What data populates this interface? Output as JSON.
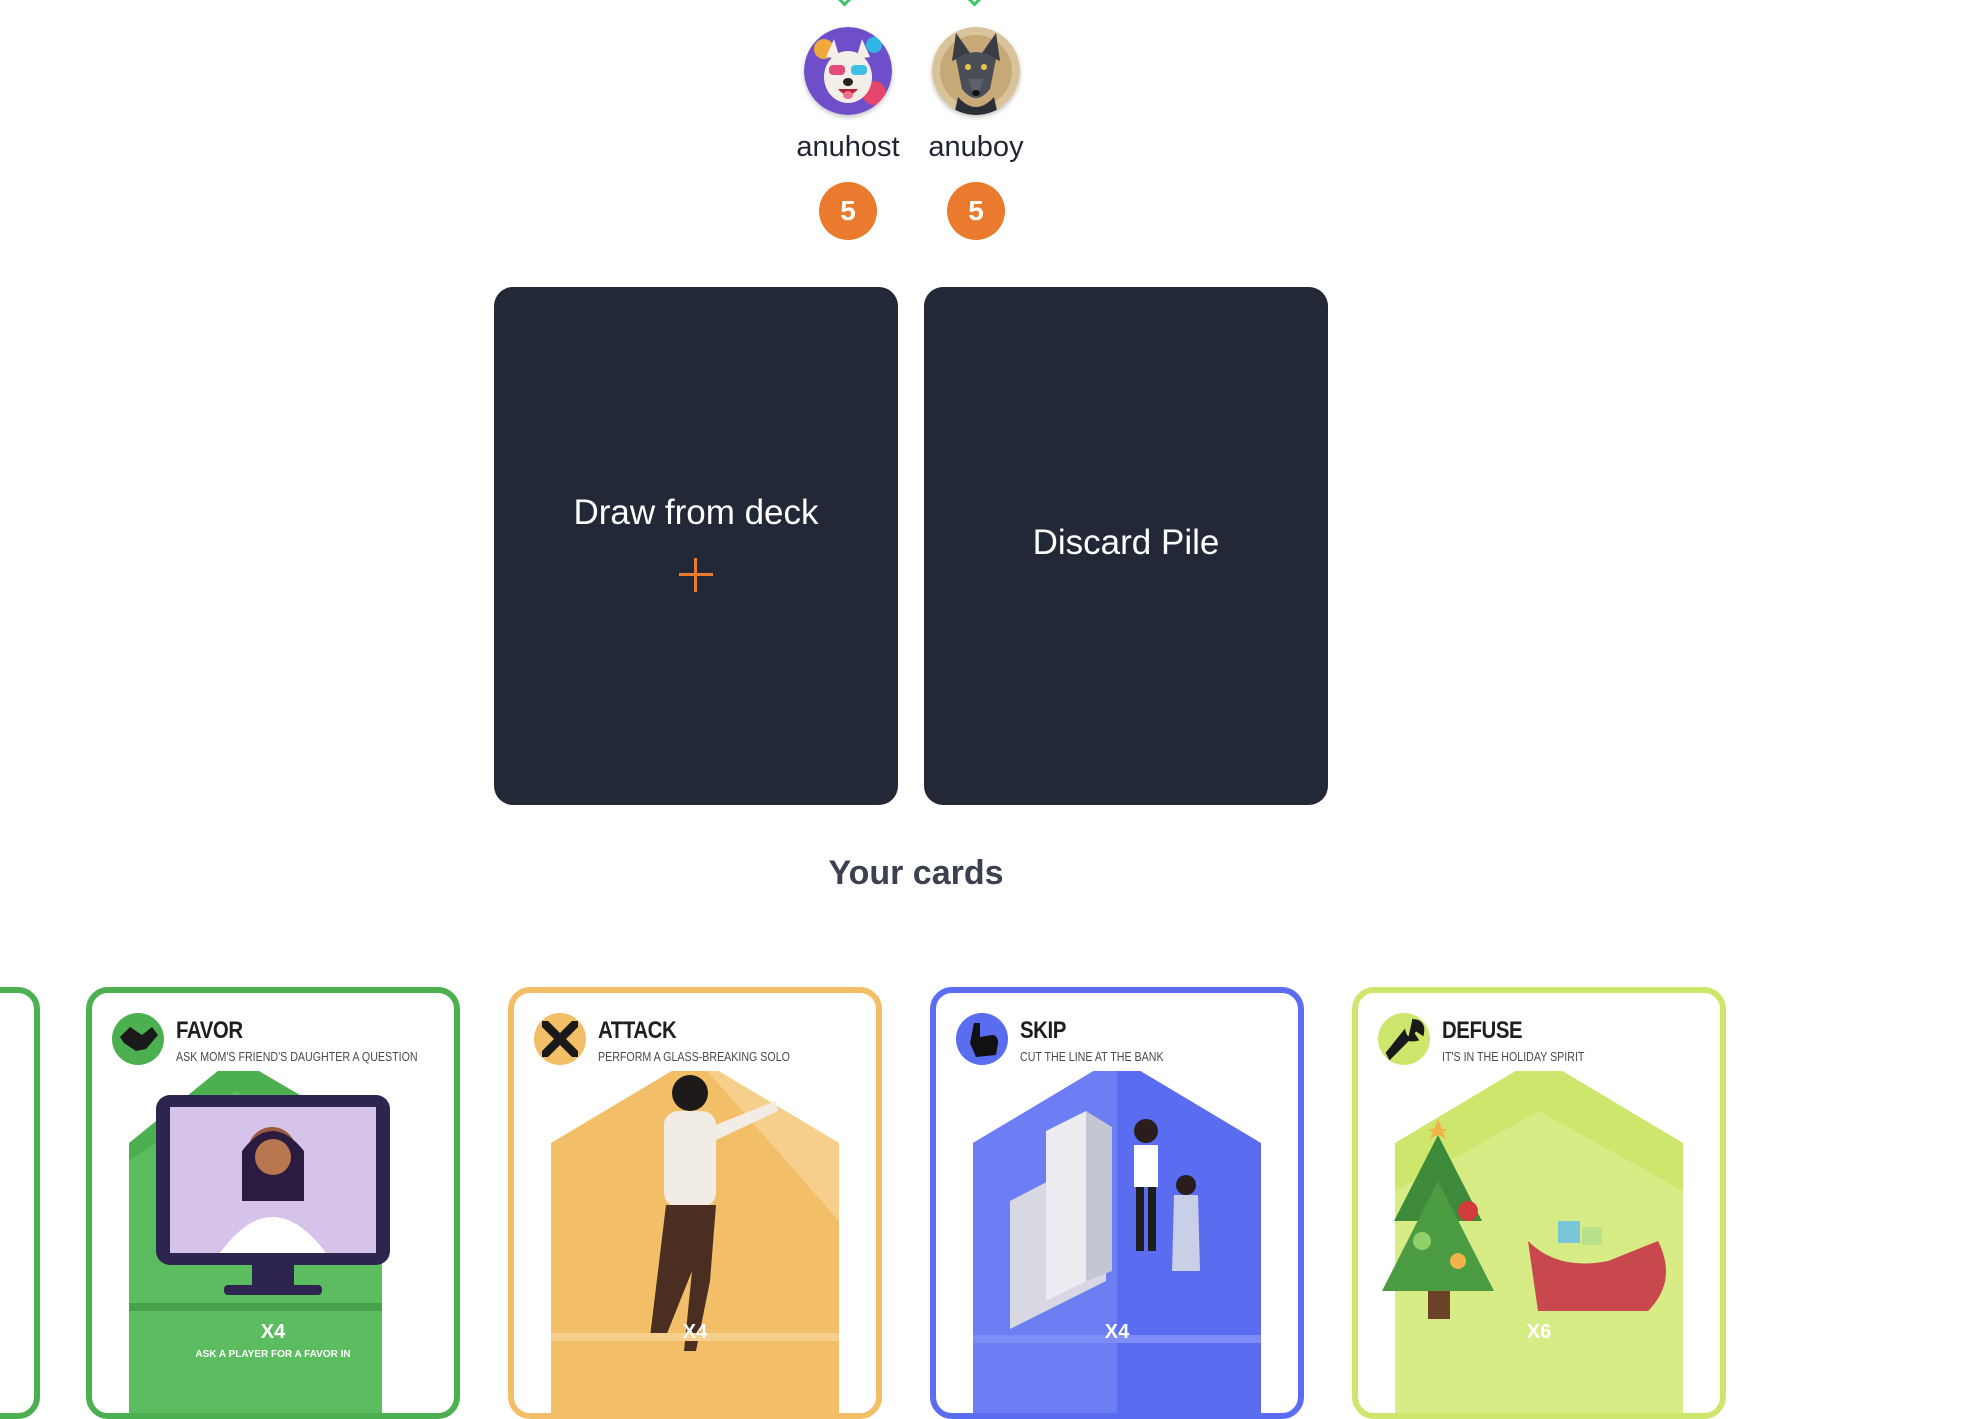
{
  "players": [
    {
      "name": "anuhost",
      "card_count": "5",
      "avatar": "dog-avatar-icon"
    },
    {
      "name": "anuboy",
      "card_count": "5",
      "avatar": "wolf-avatar-icon"
    }
  ],
  "piles": {
    "draw_label": "Draw from deck",
    "discard_label": "Discard Pile"
  },
  "hand": {
    "title": "Your cards",
    "cards": [
      {
        "name": "FAVOR",
        "subtitle": "ASK MOM'S FRIEND'S DAUGHTER A QUESTION",
        "multiplier": "X4",
        "text": "ASK A PLAYER FOR A FAVOR IN",
        "color": "#4caf50",
        "icon": "handshake-icon"
      },
      {
        "name": "ATTACK",
        "subtitle": "PERFORM A GLASS-BREAKING SOLO",
        "multiplier": "X4",
        "text": "",
        "color": "#f3be68",
        "icon": "crossed-swords-icon"
      },
      {
        "name": "SKIP",
        "subtitle": "CUT THE LINE AT THE BANK",
        "multiplier": "X4",
        "text": "",
        "color": "#5a6cf0",
        "icon": "skip-hand-icon"
      },
      {
        "name": "DEFUSE",
        "subtitle": "IT'S IN THE HOLIDAY SPIRIT",
        "multiplier": "X6",
        "text": "",
        "color": "#cde66c",
        "icon": "wrench-icon"
      }
    ]
  },
  "colors": {
    "pile_bg": "#222836",
    "badge": "#ea7a2d",
    "accent_plus": "#ea7a2d"
  }
}
